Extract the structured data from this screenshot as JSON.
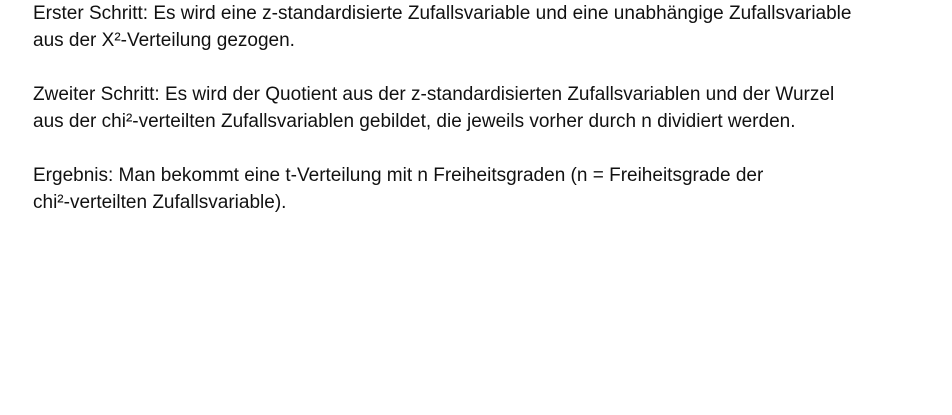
{
  "paragraphs": [
    {
      "lines": [
        "Erster Schritt: Es wird eine z-standardisierte Zufallsvariable und eine unabhängige Zufallsvariable",
        "aus der X²-Verteilung gezogen."
      ]
    },
    {
      "lines": [
        "Zweiter Schritt: Es wird der Quotient aus der z-standardisierten Zufallsvariablen und der Wurzel",
        "aus der chi²-verteilten Zufallsvariablen gebildet, die jeweils vorher durch n dividiert werden."
      ]
    },
    {
      "lines": [
        "Ergebnis: Man bekommt eine t-Verteilung mit n Freiheitsgraden (n = Freiheitsgrade der",
        "chi²-verteilten Zufallsvariable)."
      ]
    }
  ]
}
